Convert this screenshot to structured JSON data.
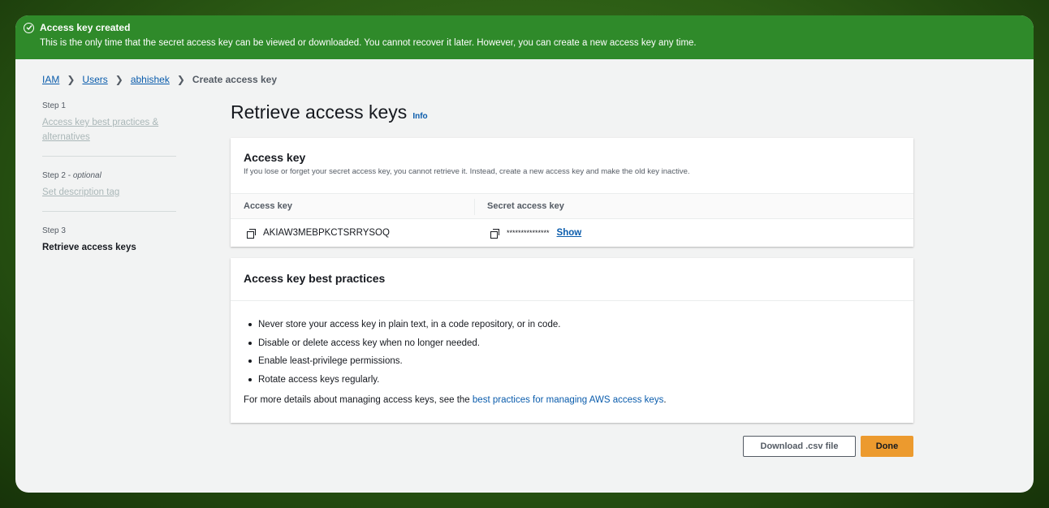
{
  "banner": {
    "title": "Access key created",
    "message": "This is the only time that the secret access key can be viewed or downloaded. You cannot recover it later. However, you can create a new access key any time.",
    "color": "#2f8a2a"
  },
  "breadcrumb": {
    "items": [
      "IAM",
      "Users",
      "abhishek"
    ],
    "current": "Create access key"
  },
  "steps": [
    {
      "label": "Step 1",
      "optional": "",
      "title": "Access key best practices & alternatives"
    },
    {
      "label": "Step 2",
      "optional": "optional",
      "title": "Set description tag"
    },
    {
      "label": "Step 3",
      "optional": "",
      "title": "Retrieve access keys"
    }
  ],
  "page": {
    "title": "Retrieve access keys",
    "info": "Info"
  },
  "access_key_card": {
    "title": "Access key",
    "subtitle": "If you lose or forget your secret access key, you cannot retrieve it. Instead, create a new access key and make the old key inactive.",
    "col_access_key": "Access key",
    "col_secret_key": "Secret access key",
    "access_key_value": "AKIAW3MEBPKCTSRRYSOQ",
    "secret_key_value": "***************",
    "show_label": "Show"
  },
  "best_practices": {
    "title": "Access key best practices",
    "items": [
      "Never store your access key in plain text, in a code repository, or in code.",
      "Disable or delete access key when no longer needed.",
      "Enable least-privilege permissions.",
      "Rotate access keys regularly."
    ],
    "more_prefix": "For more details about managing access keys, see the ",
    "more_link": "best practices for managing AWS access keys",
    "more_suffix": "."
  },
  "actions": {
    "download_label": "Download .csv file",
    "done_label": "Done",
    "primary_color": "#ec9a2e"
  }
}
